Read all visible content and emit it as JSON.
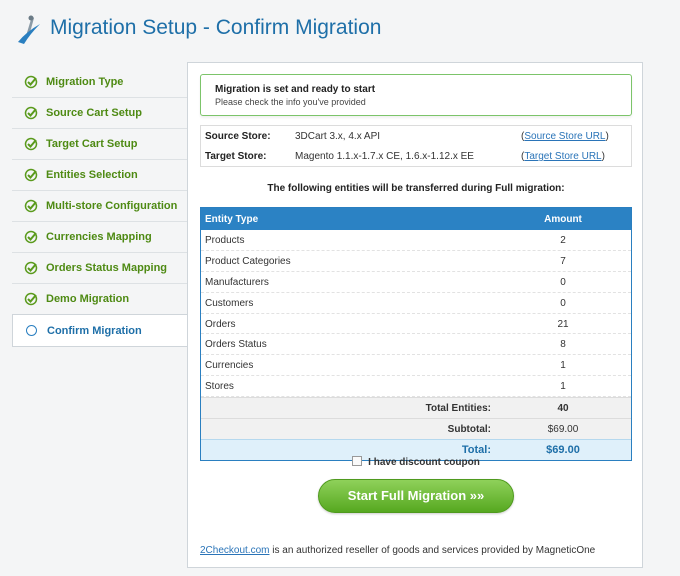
{
  "header": {
    "title": "Migration Setup - Confirm Migration"
  },
  "sidebar": {
    "items": [
      {
        "label": "Migration Type"
      },
      {
        "label": "Source Cart Setup"
      },
      {
        "label": "Target Cart Setup"
      },
      {
        "label": "Entities Selection"
      },
      {
        "label": "Multi-store Configuration"
      },
      {
        "label": "Currencies Mapping"
      },
      {
        "label": "Orders Status Mapping"
      },
      {
        "label": "Demo Migration"
      },
      {
        "label": "Confirm Migration"
      }
    ]
  },
  "notice": {
    "title": "Migration is set and ready to start",
    "text": "Please check the info you've provided"
  },
  "stores": {
    "source": {
      "label": "Source Store:",
      "value": "3DCart 3.x, 4.x API",
      "link": "Source Store URL"
    },
    "target": {
      "label": "Target Store:",
      "value": "Magento 1.1.x-1.7.x CE, 1.6.x-1.12.x EE",
      "link": "Target Store URL"
    }
  },
  "intro": "The following entities will be transferred during Full migration:",
  "entities": {
    "col_type": "Entity Type",
    "col_amount": "Amount",
    "rows": [
      {
        "name": "Products",
        "amount": "2"
      },
      {
        "name": "Product Categories",
        "amount": "7"
      },
      {
        "name": "Manufacturers",
        "amount": "0"
      },
      {
        "name": "Customers",
        "amount": "0"
      },
      {
        "name": "Orders",
        "amount": "21"
      },
      {
        "name": "Orders Status",
        "amount": "8"
      },
      {
        "name": "Currencies",
        "amount": "1"
      },
      {
        "name": "Stores",
        "amount": "1"
      }
    ],
    "total_entities_label": "Total Entities:",
    "total_entities": "40",
    "subtotal_label": "Subtotal:",
    "subtotal": "$69.00",
    "total_label": "Total:",
    "total": "$69.00"
  },
  "coupon_label": "I have discount coupon",
  "start_button": "Start Full Migration »»",
  "footer": {
    "link": "2Checkout.com",
    "text": " is an authorized reseller of goods and services provided by MagneticOne"
  },
  "colors": {
    "accent": "#1e6fa8",
    "success": "#4e8a13",
    "button": "#56a820"
  }
}
